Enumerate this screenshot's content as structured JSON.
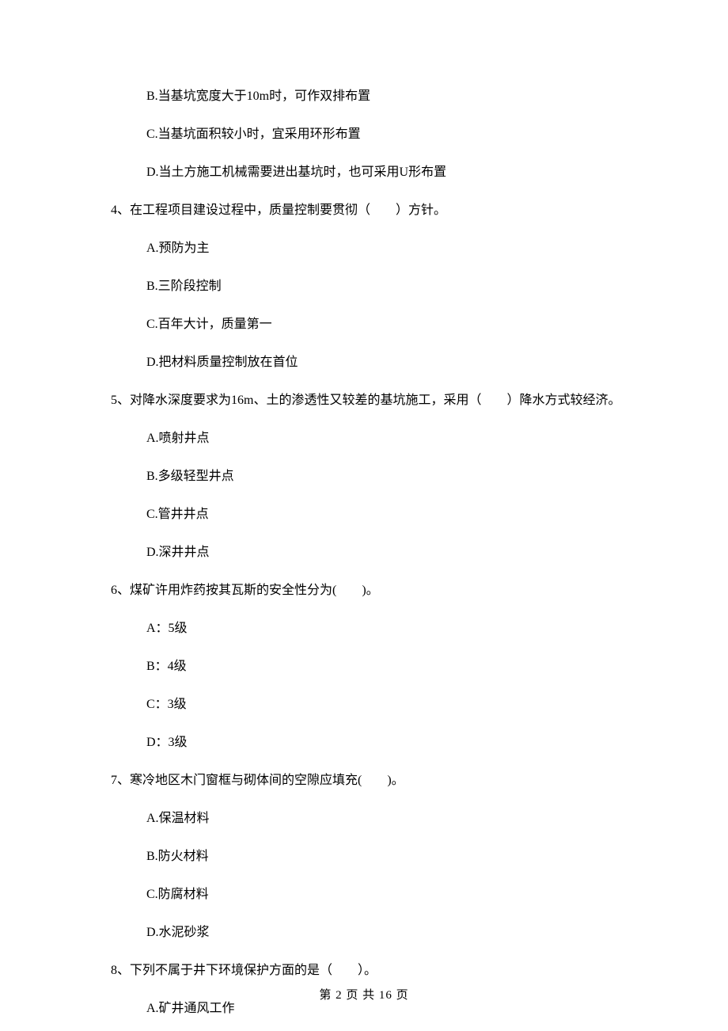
{
  "q3": {
    "options": {
      "b": "B.当基坑宽度大于10m时，可作双排布置",
      "c": "C.当基坑面积较小时，宜采用环形布置",
      "d": "D.当土方施工机械需要进出基坑时，也可采用U形布置"
    }
  },
  "q4": {
    "text": "4、在工程项目建设过程中，质量控制要贯彻（　　）方针。",
    "options": {
      "a": "A.预防为主",
      "b": "B.三阶段控制",
      "c": "C.百年大计，质量第一",
      "d": "D.把材料质量控制放在首位"
    }
  },
  "q5": {
    "text": "5、对降水深度要求为16m、土的渗透性又较差的基坑施工，采用（　　）降水方式较经济。",
    "options": {
      "a": "A.喷射井点",
      "b": "B.多级轻型井点",
      "c": "C.管井井点",
      "d": "D.深井井点"
    }
  },
  "q6": {
    "text": "6、煤矿许用炸药按其瓦斯的安全性分为(　　)。",
    "options": {
      "a": "A：5级",
      "b": "B：4级",
      "c": "C：3级",
      "d": "D：3级"
    }
  },
  "q7": {
    "text": "7、寒冷地区木门窗框与砌体间的空隙应填充(　　)。",
    "options": {
      "a": "A.保温材料",
      "b": "B.防火材料",
      "c": "C.防腐材料",
      "d": "D.水泥砂浆"
    }
  },
  "q8": {
    "text": "8、下列不属于井下环境保护方面的是（　　）。",
    "options": {
      "a": "A.矿井通风工作"
    }
  },
  "footer": "第 2 页 共 16 页"
}
